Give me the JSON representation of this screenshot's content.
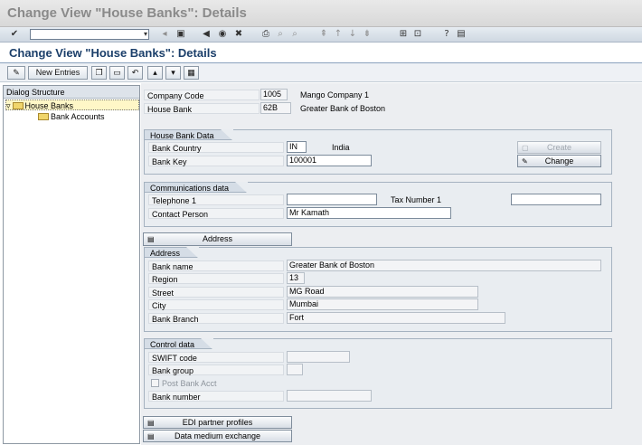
{
  "window": {
    "title": "Change View \"House Banks\": Details"
  },
  "command_field": {
    "value": ""
  },
  "header": {
    "title": "Change View \"House Banks\": Details"
  },
  "app_toolbar": {
    "new_entries_label": "New Entries"
  },
  "dialog_structure": {
    "title": "Dialog Structure",
    "items": [
      {
        "label": "House Banks",
        "selected": true,
        "expanded": true
      },
      {
        "label": "Bank Accounts",
        "selected": false
      }
    ]
  },
  "company_code": {
    "label": "Company Code",
    "value": "1005",
    "description": "Mango Company 1"
  },
  "house_bank": {
    "label": "House Bank",
    "value": "62B",
    "description": "Greater Bank of Boston"
  },
  "house_bank_data": {
    "title": "House Bank Data",
    "bank_country": {
      "label": "Bank Country",
      "value": "IN",
      "description": "India"
    },
    "bank_key": {
      "label": "Bank Key",
      "value": "100001"
    },
    "create_label": "Create",
    "change_label": "Change"
  },
  "communications": {
    "title": "Communications data",
    "telephone": {
      "label": "Telephone 1",
      "value": ""
    },
    "tax_number": {
      "label": "Tax Number 1",
      "value": ""
    },
    "contact_person": {
      "label": "Contact Person",
      "value": "Mr Kamath"
    }
  },
  "address_button": {
    "label": "Address"
  },
  "address": {
    "title": "Address",
    "bank_name": {
      "label": "Bank name",
      "value": "Greater Bank of Boston"
    },
    "region": {
      "label": "Region",
      "value": "13"
    },
    "street": {
      "label": "Street",
      "value": "MG Road"
    },
    "city": {
      "label": "City",
      "value": "Mumbai"
    },
    "bank_branch": {
      "label": "Bank Branch",
      "value": "Fort"
    }
  },
  "control_data": {
    "title": "Control data",
    "swift": {
      "label": "SWIFT code",
      "value": ""
    },
    "bank_group": {
      "label": "Bank group",
      "value": ""
    },
    "post_bank_acct": {
      "label": "Post Bank Acct",
      "checked": false
    },
    "bank_number": {
      "label": "Bank number",
      "value": ""
    }
  },
  "bottom_buttons": {
    "edi_label": "EDI partner profiles",
    "dme_label": "Data medium exchange"
  }
}
